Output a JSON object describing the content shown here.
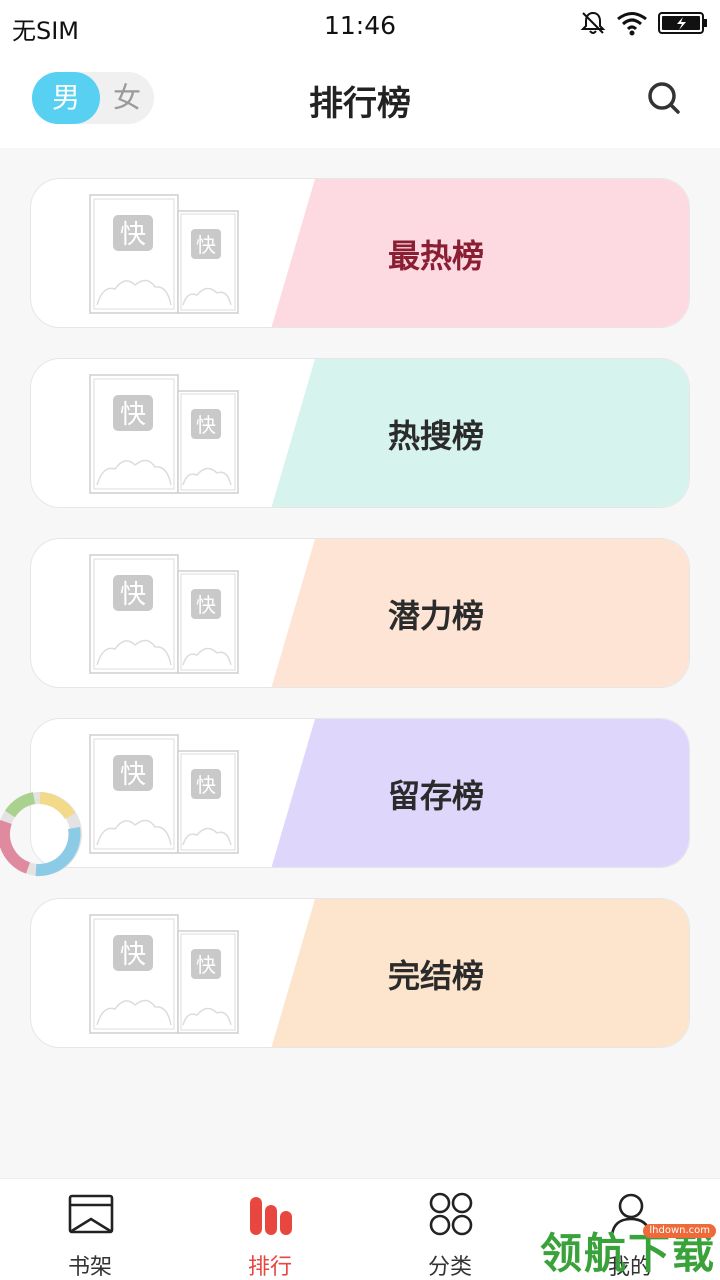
{
  "status_bar": {
    "carrier": "无SIM",
    "time": "11:46",
    "icons": [
      "mute-bell-icon",
      "wifi-icon",
      "battery-charging-icon"
    ]
  },
  "header": {
    "gender_toggle": {
      "male": "男",
      "female": "女",
      "selected": "男"
    },
    "title": "排行榜",
    "search_icon": "search-icon"
  },
  "rank_lists": [
    {
      "label": "最热榜",
      "color": "#fdd9e1",
      "text_color": "#8a1f33",
      "cover_icon": "book-cover-placeholder",
      "cover_mark": "快"
    },
    {
      "label": "热搜榜",
      "color": "#d6f3ed",
      "text_color": "#2b2b2b",
      "cover_icon": "book-cover-placeholder",
      "cover_mark": "快"
    },
    {
      "label": "潜力榜",
      "color": "#fde4d5",
      "text_color": "#2b2b2b",
      "cover_icon": "book-cover-placeholder",
      "cover_mark": "快"
    },
    {
      "label": "留存榜",
      "color": "#dfd6fc",
      "text_color": "#2b2b2b",
      "cover_icon": "book-cover-placeholder",
      "cover_mark": "快"
    },
    {
      "label": "完结榜",
      "color": "#fde4cc",
      "text_color": "#2b2b2b",
      "cover_icon": "book-cover-placeholder",
      "cover_mark": "快"
    }
  ],
  "floating_widget": {
    "icon": "loading-ring-icon"
  },
  "tab_bar": {
    "active": "排行",
    "active_color": "#e8473f",
    "tabs": [
      {
        "label": "书架",
        "icon": "bookshelf-icon"
      },
      {
        "label": "排行",
        "icon": "ranking-bars-icon"
      },
      {
        "label": "分类",
        "icon": "category-grid-icon"
      },
      {
        "label": "我的",
        "icon": "profile-icon"
      }
    ]
  },
  "watermark": {
    "text": "领航下载",
    "url": "lhdown.com"
  }
}
